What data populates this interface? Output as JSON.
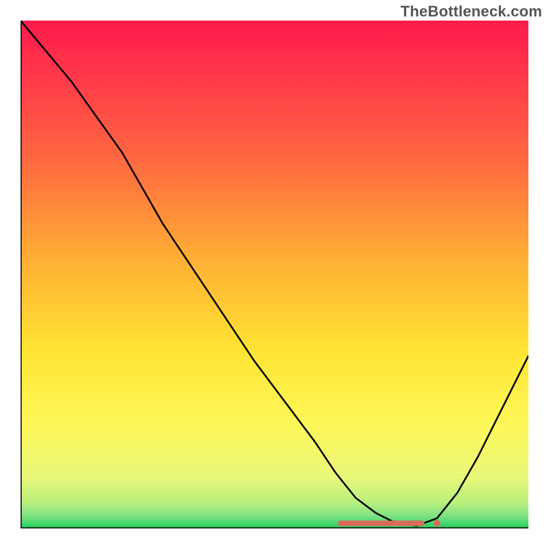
{
  "watermark": "TheBottleneck.com",
  "colors": {
    "gradient_stops": [
      {
        "offset": 0.0,
        "color": "#ff1a4b"
      },
      {
        "offset": 0.12,
        "color": "#ff3b4a"
      },
      {
        "offset": 0.28,
        "color": "#ff6a3f"
      },
      {
        "offset": 0.48,
        "color": "#ffb233"
      },
      {
        "offset": 0.65,
        "color": "#ffe433"
      },
      {
        "offset": 0.8,
        "color": "#fdf85a"
      },
      {
        "offset": 0.9,
        "color": "#e8f77a"
      },
      {
        "offset": 0.95,
        "color": "#b8ef7d"
      },
      {
        "offset": 0.975,
        "color": "#7fe283"
      },
      {
        "offset": 1.0,
        "color": "#1ecf5f"
      }
    ],
    "axis": "#000000",
    "curve": "#000000",
    "marker": "#d96b5b"
  },
  "chart_data": {
    "type": "line",
    "title": "",
    "xlabel": "",
    "ylabel": "",
    "xlim": [
      0,
      100
    ],
    "ylim": [
      0,
      100
    ],
    "x": [
      0,
      5,
      10,
      15,
      20,
      24,
      28,
      34,
      40,
      46,
      52,
      58,
      62,
      66,
      70,
      74,
      78,
      82,
      86,
      90,
      94,
      100
    ],
    "values": [
      100,
      94,
      88,
      81,
      74,
      67,
      60,
      51,
      42,
      33,
      25,
      17,
      11,
      6,
      3,
      1,
      0.5,
      2,
      7,
      14,
      22,
      34
    ],
    "marker_band": {
      "x_start": 63,
      "x_end": 79,
      "y": 1
    },
    "marker_dot": {
      "x": 82,
      "y": 1
    }
  }
}
